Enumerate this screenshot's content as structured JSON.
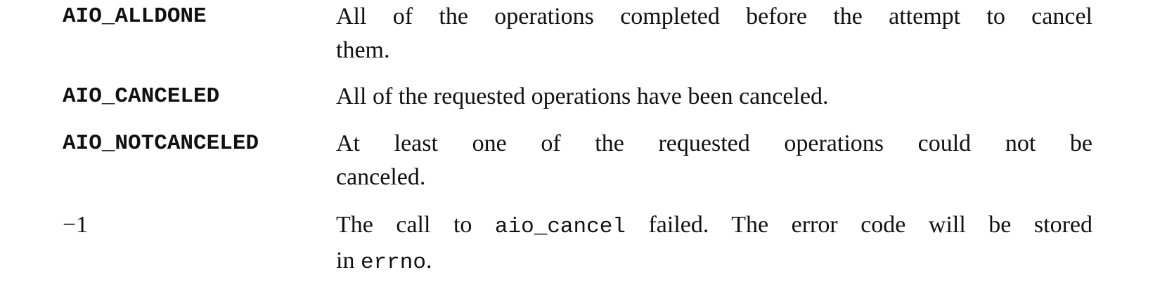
{
  "return_values": [
    {
      "term": "AIO_ALLDONE",
      "desc_line1": "All of the operations completed before the attempt to cancel",
      "desc_line2": "them."
    },
    {
      "term": "AIO_CANCELED",
      "desc_line1": "All of the requested operations have been canceled."
    },
    {
      "term": "AIO_NOTCANCELED",
      "desc_line1": "At least one of the requested operations could not be",
      "desc_line2": "canceled."
    },
    {
      "term": "−1",
      "desc_pre": "The call to",
      "desc_code": "aio_cancel",
      "desc_post": "failed.  The error code will be stored",
      "desc_line2_pre": "in",
      "desc_line2_code": "errno",
      "desc_line2_post": "."
    }
  ]
}
